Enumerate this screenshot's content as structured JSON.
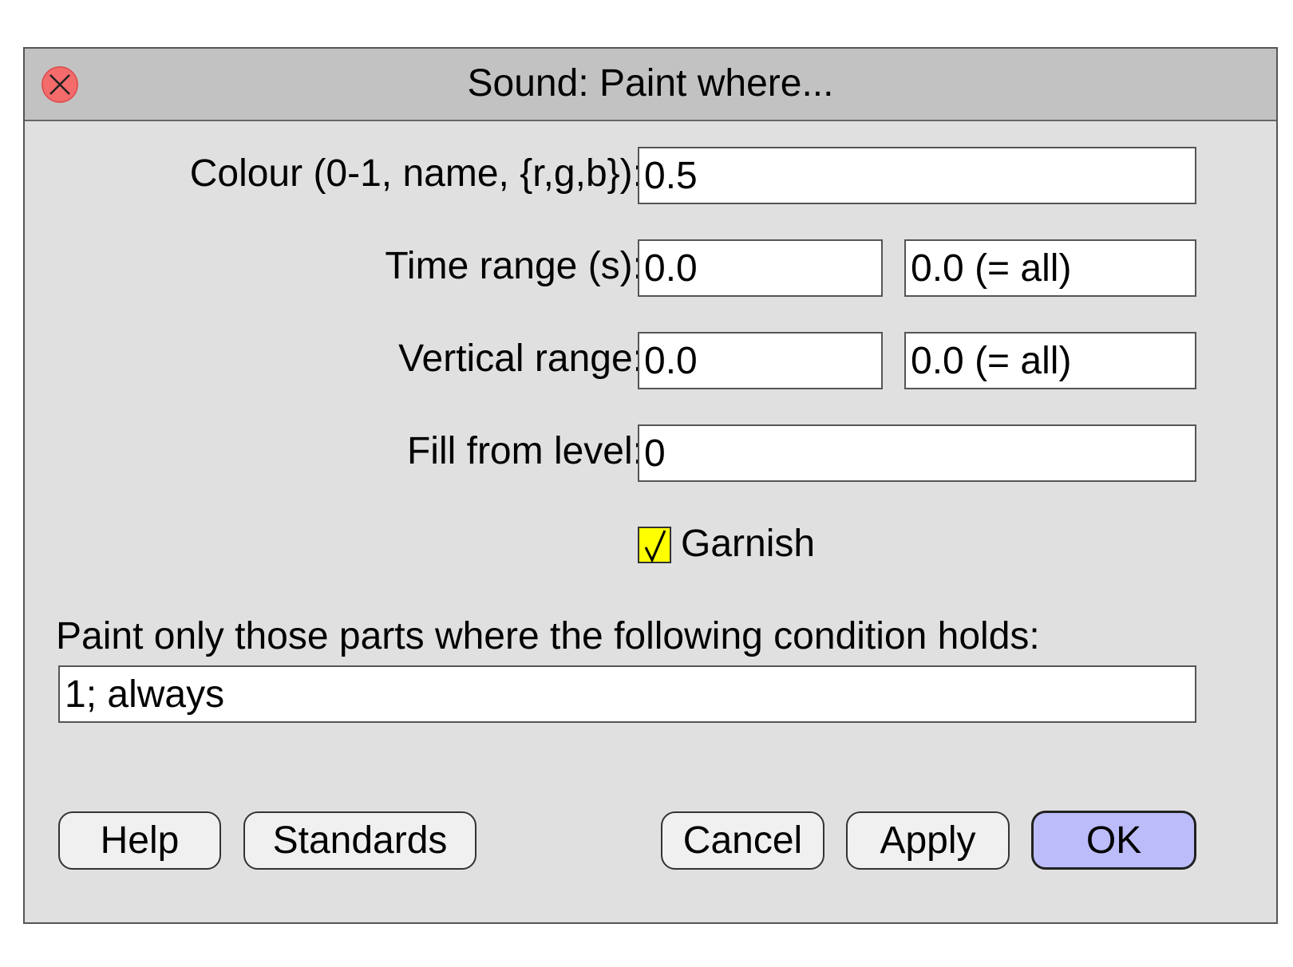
{
  "window": {
    "title": "Sound: Paint where..."
  },
  "form": {
    "colour": {
      "label": "Colour (0-1, name, {r,g,b}):",
      "value": "0.5"
    },
    "time_range": {
      "label": "Time range (s):",
      "from": "0.0",
      "to": "0.0 (= all)"
    },
    "vertical_range": {
      "label": "Vertical range:",
      "from": "0.0",
      "to": "0.0 (= all)"
    },
    "fill_from_level": {
      "label": "Fill from level:",
      "value": "0"
    },
    "garnish": {
      "label": "Garnish",
      "checked": true,
      "check_glyph": "√"
    },
    "condition": {
      "label": "Paint only those parts where the following condition holds:",
      "value": "1; always"
    }
  },
  "buttons": {
    "help": "Help",
    "standards": "Standards",
    "cancel": "Cancel",
    "apply": "Apply",
    "ok": "OK"
  },
  "colors": {
    "titlebar": "#c2c2c2",
    "window_bg": "#e0e0e0",
    "close_button": "#f36b6b",
    "checkbox_fill": "#ffff00",
    "ok_button": "#bcbcfa"
  },
  "icons": {
    "close": "close-x-icon",
    "checkmark": "checkmark-icon"
  }
}
